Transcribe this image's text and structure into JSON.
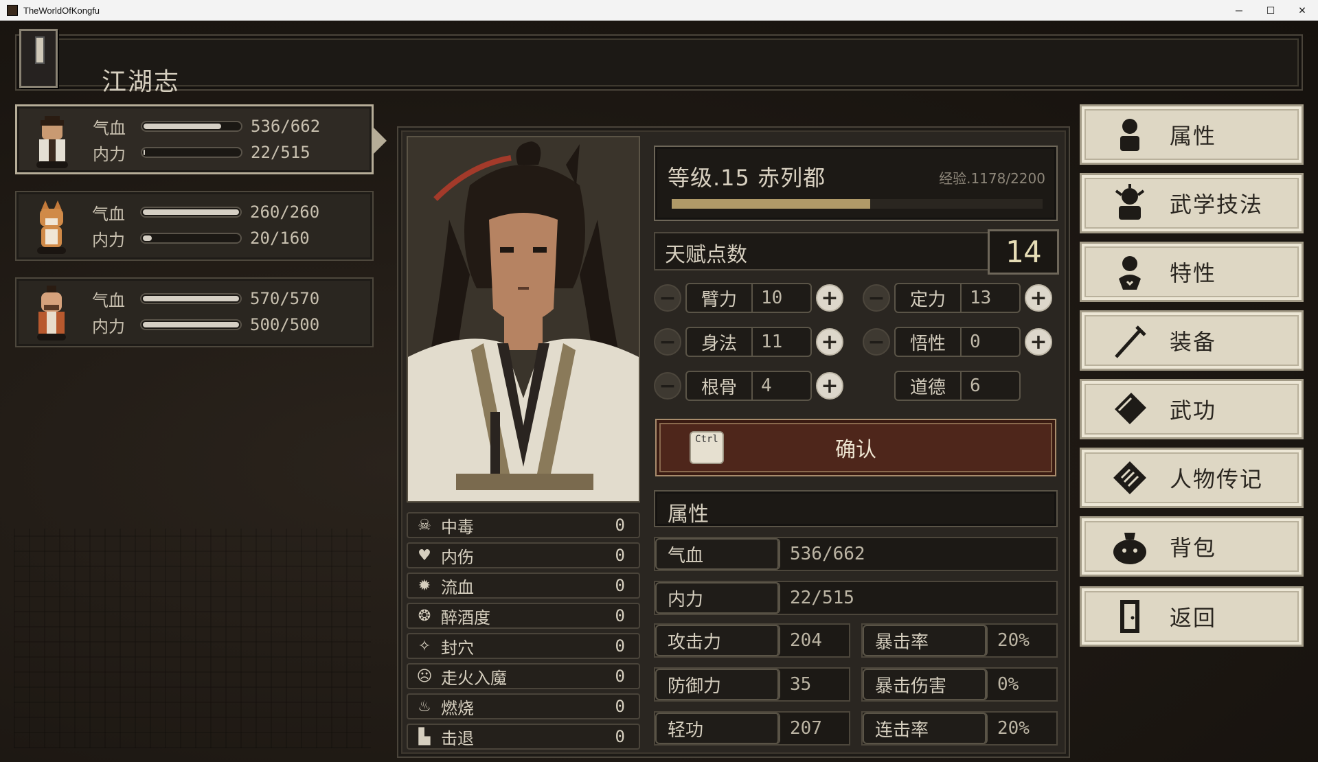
{
  "window": {
    "title": "TheWorldOfKongfu",
    "minimize": "─",
    "maximize": "☐",
    "close": "✕"
  },
  "header": {
    "title": "江湖志"
  },
  "party": [
    {
      "hp_label": "气血",
      "hp_value": "536/662",
      "hp_fraction": 0.81,
      "mp_label": "内力",
      "mp_value": "22/515",
      "mp_fraction": 0.04
    },
    {
      "hp_label": "气血",
      "hp_value": "260/260",
      "hp_fraction": 1.0,
      "mp_label": "内力",
      "mp_value": "20/160",
      "mp_fraction": 0.12
    },
    {
      "hp_label": "气血",
      "hp_value": "570/570",
      "hp_fraction": 1.0,
      "mp_label": "内力",
      "mp_value": "500/500",
      "mp_fraction": 1.0
    }
  ],
  "character": {
    "level_name": "等级.15 赤列都",
    "exp": "经验.1178/2200",
    "exp_fraction": 0.535,
    "talent_label": "天赋点数",
    "talent_points": "14"
  },
  "attributes": [
    {
      "name": "臂力",
      "value": "10"
    },
    {
      "name": "定力",
      "value": "13"
    },
    {
      "name": "身法",
      "value": "11"
    },
    {
      "name": "悟性",
      "value": "0"
    },
    {
      "name": "根骨",
      "value": "4"
    },
    {
      "name": "道德",
      "value": "6"
    }
  ],
  "buttons": {
    "minus": "−",
    "plus": "+",
    "confirm": "确认",
    "ctrl_key": "Ctrl"
  },
  "status_effects": [
    {
      "name": "中毒",
      "value": "0",
      "icon": "☠"
    },
    {
      "name": "内伤",
      "value": "0",
      "icon": "♥"
    },
    {
      "name": "流血",
      "value": "0",
      "icon": "✹"
    },
    {
      "name": "醉酒度",
      "value": "0",
      "icon": "❂"
    },
    {
      "name": "封穴",
      "value": "0",
      "icon": "✧"
    },
    {
      "name": "走火入魔",
      "value": "0",
      "icon": "☹"
    },
    {
      "name": "燃烧",
      "value": "0",
      "icon": "♨"
    },
    {
      "name": "击退",
      "value": "0",
      "icon": "▙"
    }
  ],
  "detail": {
    "header": "属性",
    "hp_label": "气血",
    "hp_value": "536/662",
    "mp_label": "内力",
    "mp_value": "22/515",
    "attack_label": "攻击力",
    "attack_value": "204",
    "crit_rate_label": "暴击率",
    "crit_rate_value": "20%",
    "defense_label": "防御力",
    "defense_value": "35",
    "crit_dmg_label": "暴击伤害",
    "crit_dmg_value": "0%",
    "qinggong_label": "轻功",
    "qinggong_value": "207",
    "combo_label": "连击率",
    "combo_value": "20%"
  },
  "menu": [
    {
      "label": "属性",
      "icon": "person-icon"
    },
    {
      "label": "武学技法",
      "icon": "martial-skill-icon"
    },
    {
      "label": "特性",
      "icon": "trait-icon"
    },
    {
      "label": "装备",
      "icon": "sword-icon"
    },
    {
      "label": "武功",
      "icon": "book-icon"
    },
    {
      "label": "人物传记",
      "icon": "scroll-icon"
    },
    {
      "label": "背包",
      "icon": "bag-icon"
    },
    {
      "label": "返回",
      "icon": "door-icon"
    }
  ]
}
